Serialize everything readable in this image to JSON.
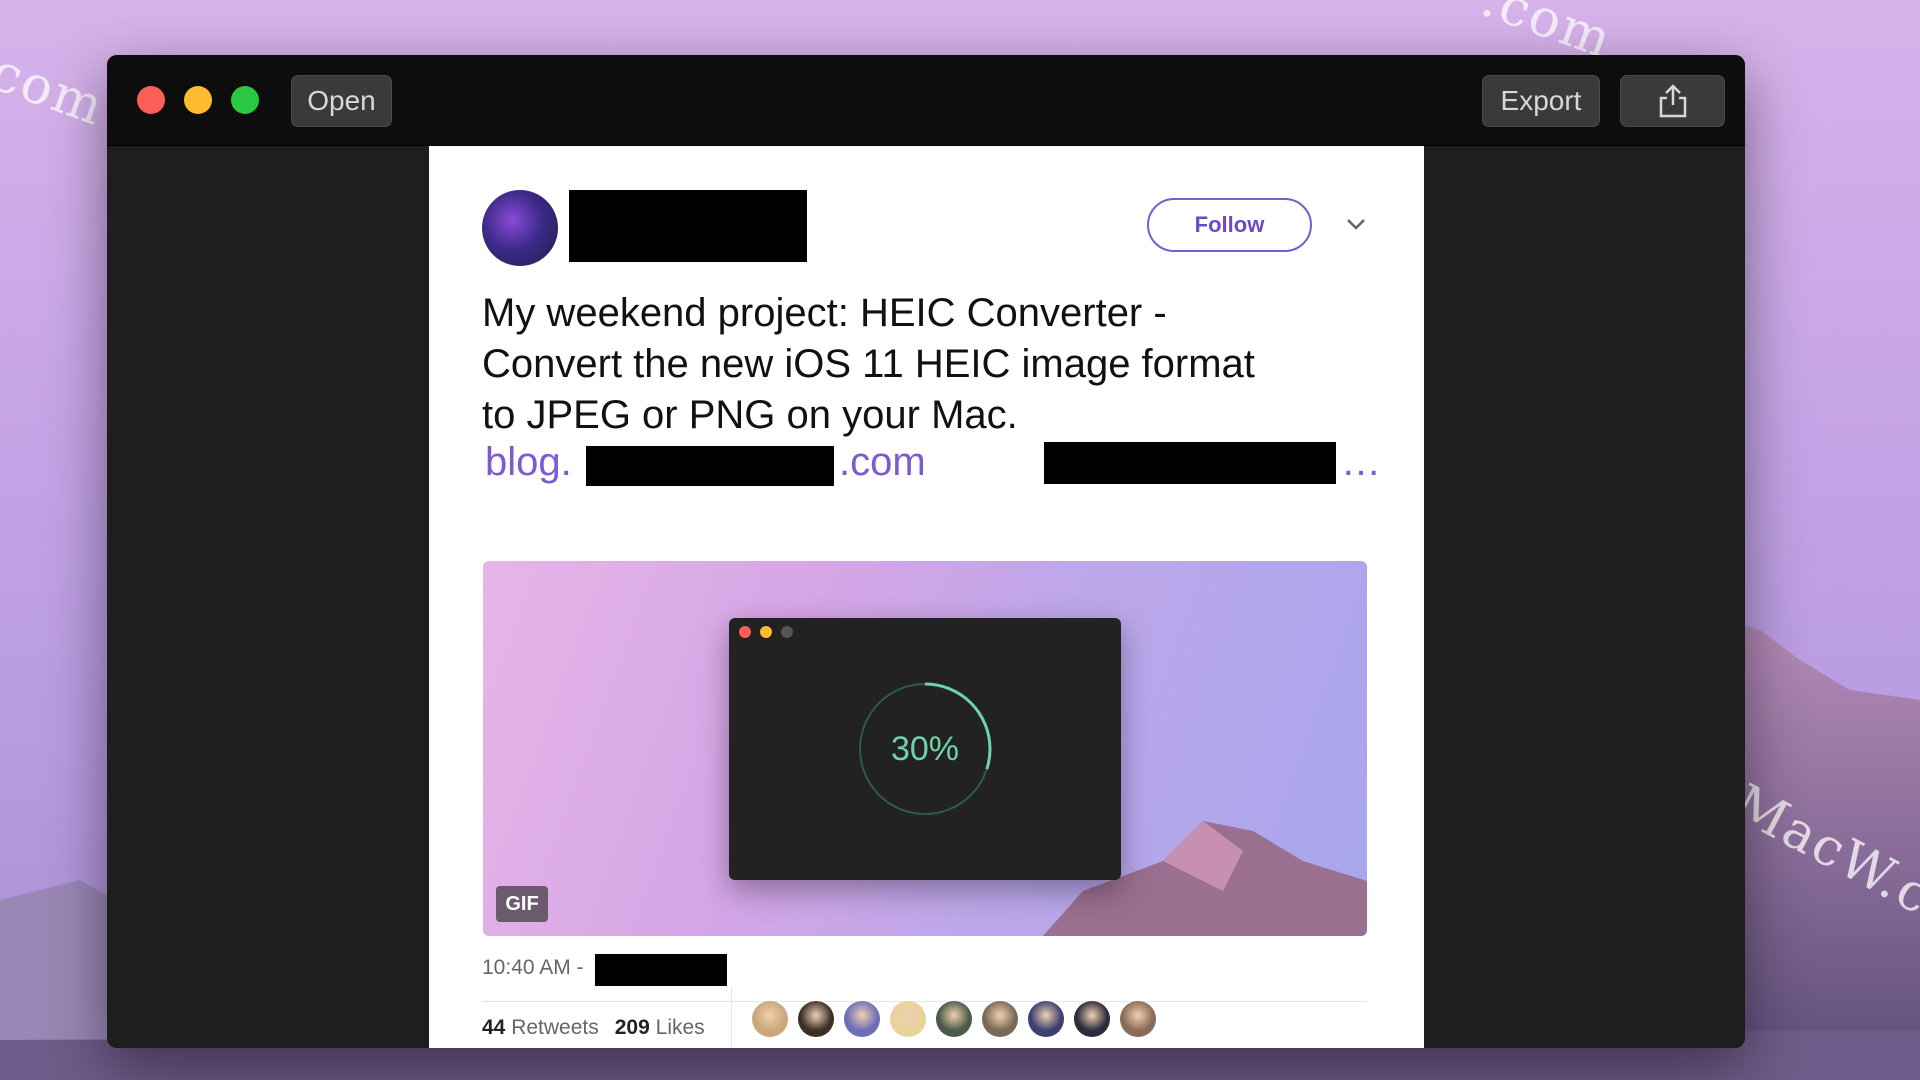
{
  "window": {
    "open_label": "Open",
    "export_label": "Export",
    "share_icon": "share-icon"
  },
  "tweet": {
    "follow_label": "Follow",
    "text_lines": [
      "My weekend project: HEIC Converter -",
      "Convert the new iOS 11 HEIC image format",
      "to JPEG or PNG on your Mac."
    ],
    "link_prefix": "blog.",
    "link_mid": ".com",
    "link_ellipsis": "…",
    "media": {
      "progress": "30%",
      "badge": "GIF"
    },
    "timestamp": "10:40 AM -",
    "retweets_count": "44",
    "retweets_label": "Retweets",
    "likes_count": "209",
    "likes_label": "Likes",
    "liker_colors": [
      "#c9a77a",
      "#3a3029",
      "#6b6fb8",
      "#e7d39a",
      "#4c5a48",
      "#7a6a55",
      "#3d3f6e",
      "#2c2a3b",
      "#8a6b57"
    ]
  },
  "watermark": "MacW.com",
  "colors": {
    "accent": "#7a5bd0",
    "progress": "#6fd3a9"
  }
}
